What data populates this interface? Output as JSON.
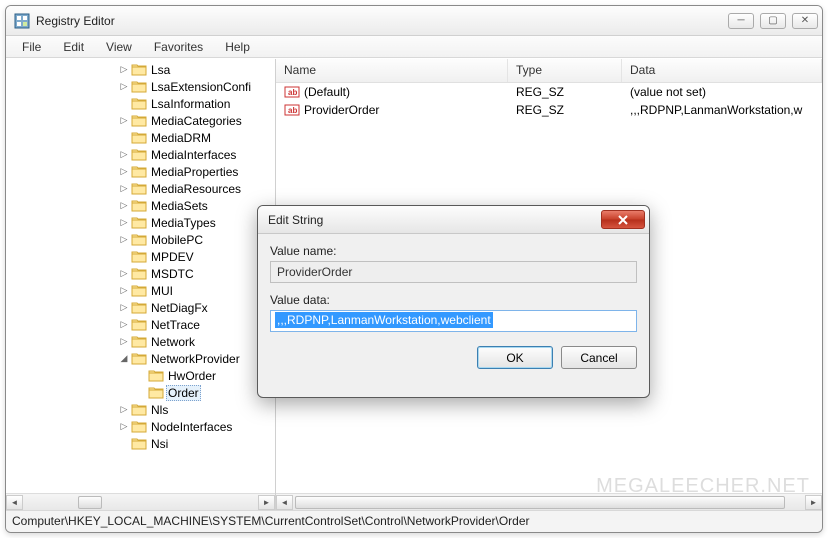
{
  "window": {
    "title": "Registry Editor"
  },
  "menu": {
    "items": [
      "File",
      "Edit",
      "View",
      "Favorites",
      "Help"
    ]
  },
  "tree": {
    "nodes": [
      {
        "label": "Lsa",
        "exp": "▷"
      },
      {
        "label": "LsaExtensionConfi",
        "exp": "▷"
      },
      {
        "label": "LsaInformation",
        "exp": ""
      },
      {
        "label": "MediaCategories",
        "exp": "▷"
      },
      {
        "label": "MediaDRM",
        "exp": ""
      },
      {
        "label": "MediaInterfaces",
        "exp": "▷"
      },
      {
        "label": "MediaProperties",
        "exp": "▷"
      },
      {
        "label": "MediaResources",
        "exp": "▷"
      },
      {
        "label": "MediaSets",
        "exp": "▷"
      },
      {
        "label": "MediaTypes",
        "exp": "▷"
      },
      {
        "label": "MobilePC",
        "exp": "▷"
      },
      {
        "label": "MPDEV",
        "exp": ""
      },
      {
        "label": "MSDTC",
        "exp": "▷"
      },
      {
        "label": "MUI",
        "exp": "▷"
      },
      {
        "label": "NetDiagFx",
        "exp": "▷"
      },
      {
        "label": "NetTrace",
        "exp": "▷"
      },
      {
        "label": "Network",
        "exp": "▷"
      },
      {
        "label": "NetworkProvider",
        "exp": "◢",
        "children": [
          {
            "label": "HwOrder"
          },
          {
            "label": "Order",
            "selected": true
          }
        ]
      },
      {
        "label": "Nls",
        "exp": "▷"
      },
      {
        "label": "NodeInterfaces",
        "exp": "▷"
      },
      {
        "label": "Nsi",
        "exp": ""
      }
    ]
  },
  "list": {
    "columns": {
      "name": "Name",
      "type": "Type",
      "data": "Data"
    },
    "rows": [
      {
        "name": "(Default)",
        "type": "REG_SZ",
        "data": "(value not set)"
      },
      {
        "name": "ProviderOrder",
        "type": "REG_SZ",
        "data": ",,,RDPNP,LanmanWorkstation,w"
      }
    ]
  },
  "statusbar": {
    "path": "Computer\\HKEY_LOCAL_MACHINE\\SYSTEM\\CurrentControlSet\\Control\\NetworkProvider\\Order"
  },
  "dialog": {
    "title": "Edit String",
    "label_name": "Value name:",
    "value_name": "ProviderOrder",
    "label_data": "Value data:",
    "value_data": ",,,RDPNP,LanmanWorkstation,webclient",
    "ok": "OK",
    "cancel": "Cancel"
  },
  "watermark": "MEGALEECHER.NET"
}
